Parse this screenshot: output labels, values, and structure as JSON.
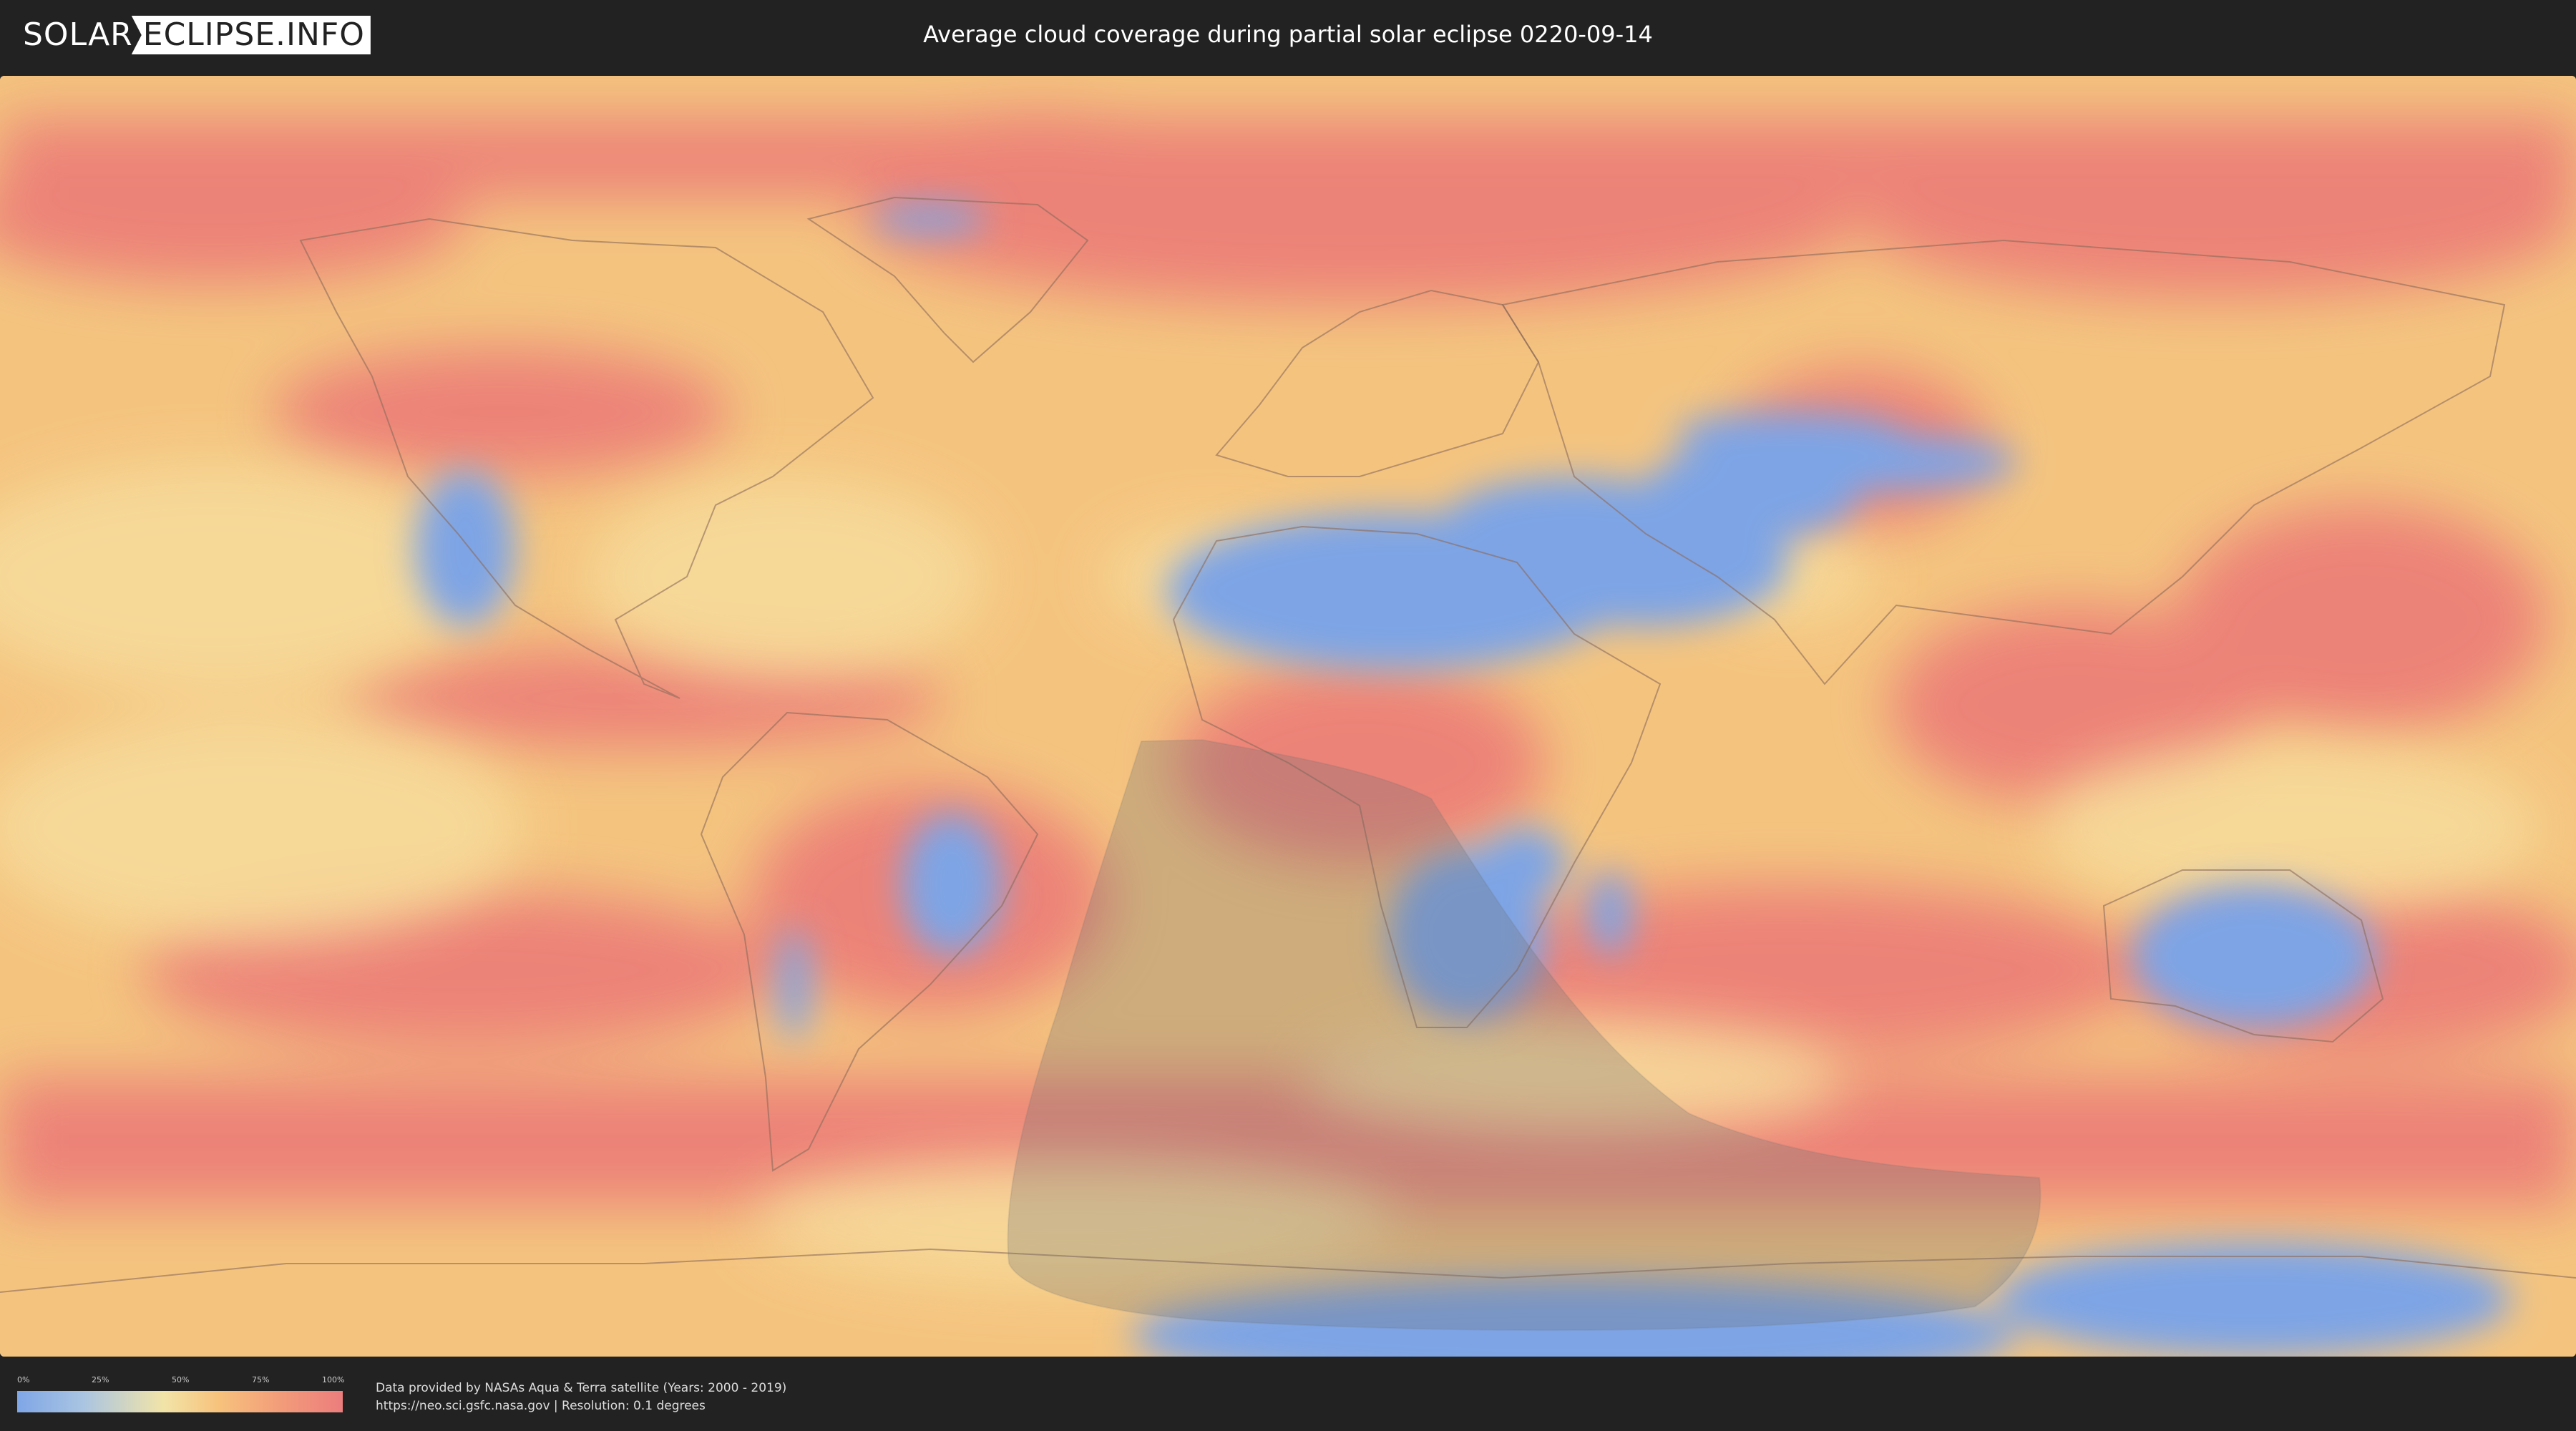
{
  "header": {
    "logo_left": "SOLAR",
    "logo_right": "ECLIPSE.INFO",
    "title": "Average cloud coverage during partial solar eclipse 0220-09-14"
  },
  "legend": {
    "ticks": [
      "0%",
      "25%",
      "50%",
      "75%",
      "100%"
    ],
    "tick_values": [
      0,
      25,
      50,
      75,
      100
    ],
    "colors": [
      "#7fa6e6",
      "#f2e4a8",
      "#f7c27c",
      "#ec7d7d"
    ]
  },
  "footer": {
    "credit_line_1": "Data provided by NASAs Aqua & Terra satellite (Years: 2000 - 2019)",
    "credit_line_2": "https://neo.sci.gsfc.nasa.gov | Resolution: 0.1 degrees"
  },
  "map": {
    "background_color": "#f3c57e",
    "cloudy_color": "#ec7f77",
    "clear_color": "#7fa6e6",
    "eclipse_shadow_color": "#6b6f73"
  }
}
